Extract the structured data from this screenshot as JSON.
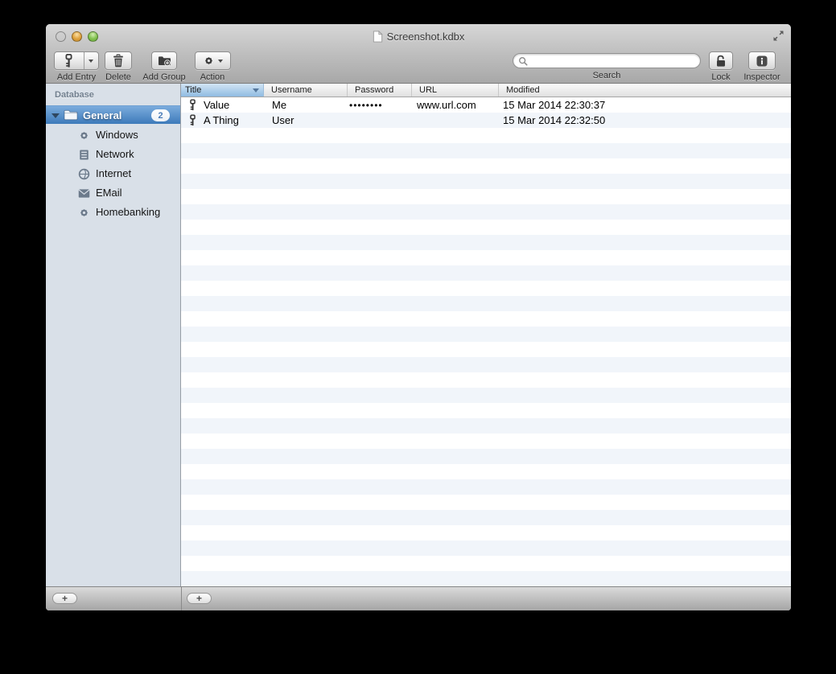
{
  "window": {
    "title": "Screenshot.kdbx"
  },
  "toolbar": {
    "add_entry_label": "Add Entry",
    "delete_label": "Delete",
    "add_group_label": "Add Group",
    "action_label": "Action",
    "search_label": "Search",
    "search_value": "",
    "lock_label": "Lock",
    "inspector_label": "Inspector"
  },
  "sidebar": {
    "header": "Database",
    "root": {
      "label": "General",
      "badge": "2",
      "selected": true,
      "icon": "folder-icon"
    },
    "items": [
      {
        "label": "Windows",
        "icon": "gear-icon"
      },
      {
        "label": "Network",
        "icon": "server-icon"
      },
      {
        "label": "Internet",
        "icon": "globe-icon"
      },
      {
        "label": "EMail",
        "icon": "envelope-icon"
      },
      {
        "label": "Homebanking",
        "icon": "gear-icon"
      }
    ]
  },
  "table": {
    "columns": [
      {
        "label": "Title",
        "sorted": "desc"
      },
      {
        "label": "Username"
      },
      {
        "label": "Password"
      },
      {
        "label": "URL"
      },
      {
        "label": "Modified"
      }
    ],
    "rows": [
      {
        "icon": "key-icon",
        "title": "Value",
        "username": "Me",
        "password": "••••••••",
        "url": "www.url.com",
        "modified": "15 Mar 2014 22:30:37"
      },
      {
        "icon": "key-icon",
        "title": "A Thing",
        "username": "User",
        "password": "",
        "url": "",
        "modified": "15 Mar 2014 22:32:50"
      }
    ]
  },
  "bottom_bar": {
    "add_group_button": "+",
    "add_entry_button": "+"
  },
  "colors": {
    "selection_top": "#7bacdd",
    "selection_bottom": "#3d7aba",
    "stripe": "#f1f5fa",
    "sidebar_bg": "#d9e0e8",
    "sort_header_top": "#d3e5f5",
    "sort_header_bottom": "#8fbbe1",
    "badge_text": "#4a7cb8"
  }
}
